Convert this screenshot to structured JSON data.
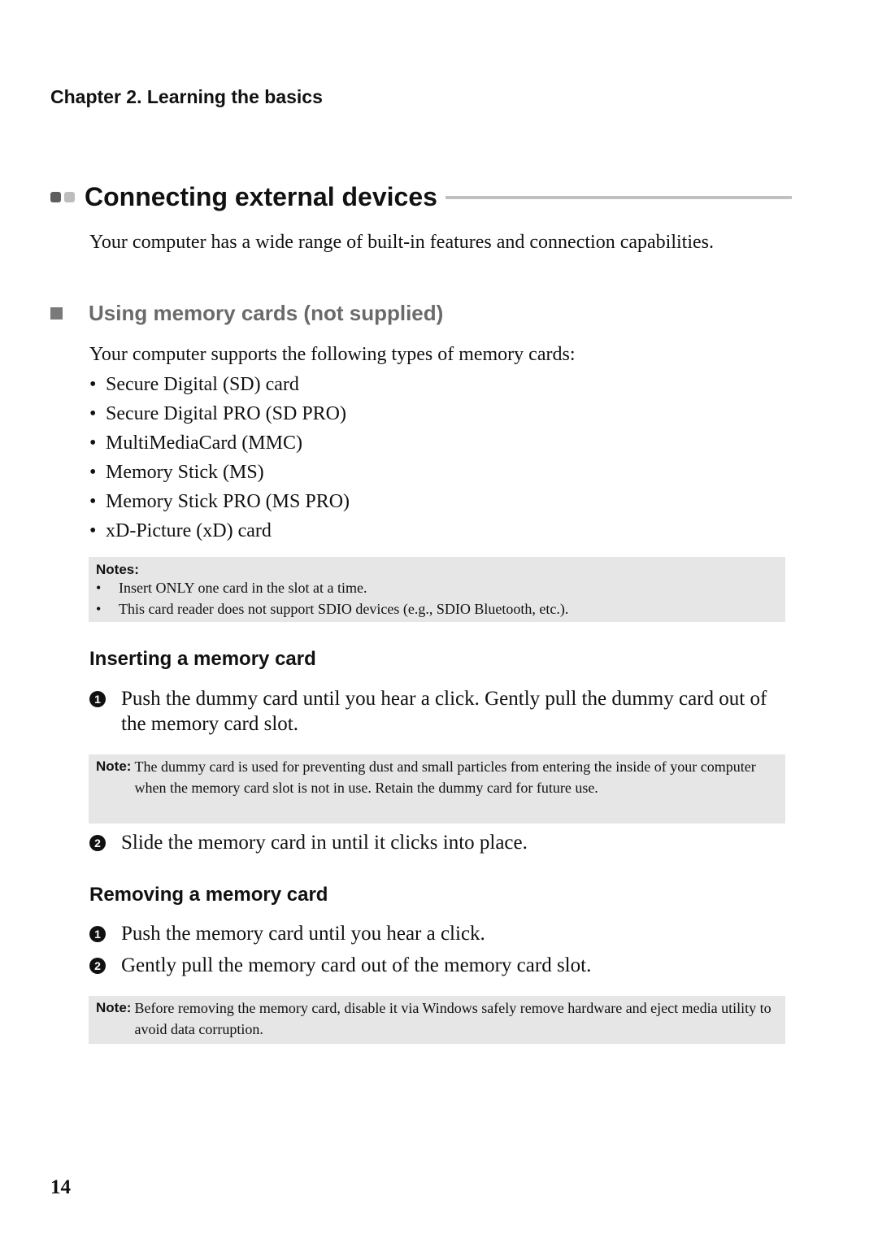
{
  "header": {
    "chapter": "Chapter 2. Learning the basics"
  },
  "section": {
    "title": "Connecting external devices",
    "intro": "Your computer has a wide range of built-in features and connection capabilities."
  },
  "subsection": {
    "title": "Using memory cards (not supplied)",
    "supports_text": "Your computer supports the following types of memory cards:",
    "card_types": [
      "Secure Digital (SD) card",
      "Secure Digital PRO (SD PRO)",
      "MultiMediaCard (MMC)",
      "Memory Stick (MS)",
      "Memory Stick PRO (MS PRO)",
      "xD-Picture (xD) card"
    ],
    "notes": {
      "label": "Notes:",
      "items": [
        "Insert ONLY one card in the slot at a time.",
        "This card reader does not support SDIO devices (e.g., SDIO Bluetooth, etc.)."
      ]
    }
  },
  "inserting": {
    "title": "Inserting a memory card",
    "steps": [
      {
        "num": "1",
        "text": "Push the dummy card until you hear a click. Gently pull the dummy card out of the memory card slot."
      },
      {
        "num": "2",
        "text": "Slide the memory card in until it clicks into place."
      }
    ],
    "note": {
      "label": "Note:",
      "text": "The dummy card is used for preventing dust and small particles from entering the inside of your computer when the memory card slot is not in use. Retain the dummy card for future use."
    }
  },
  "removing": {
    "title": "Removing a memory card",
    "steps": [
      {
        "num": "1",
        "text": "Push the memory card until you hear a click."
      },
      {
        "num": "2",
        "text": "Gently pull the memory card out of the memory card slot."
      }
    ],
    "note": {
      "label": "Note:",
      "text": "Before removing the memory card, disable it via Windows safely remove hardware and eject media utility to avoid data corruption."
    }
  },
  "footer": {
    "page_number": "14"
  },
  "colors": {
    "note_background": "#e6e6e6",
    "subheading": "#6a6a6a",
    "rule": "#c0c0c0",
    "bullet_dark": "#5e5e5e",
    "bullet_light": "#bdbdbd"
  },
  "icons": {
    "section_marker": "two-squares-icon",
    "subsection_marker": "square-bullet-icon",
    "step_number": "circled-number-icon"
  }
}
